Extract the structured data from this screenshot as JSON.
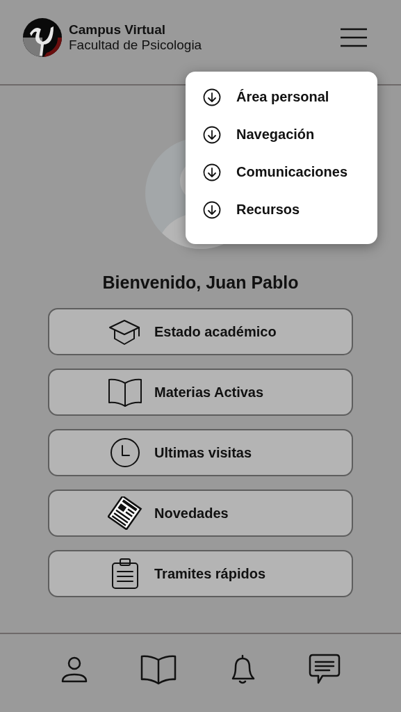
{
  "header": {
    "title": "Campus Virtual",
    "subtitle": "Facultad de Psicologia"
  },
  "menu": {
    "items": [
      {
        "label": "Área personal"
      },
      {
        "label": "Navegación"
      },
      {
        "label": "Comunicaciones"
      },
      {
        "label": "Recursos"
      }
    ]
  },
  "welcome": "Bienvenido, Juan Pablo",
  "actions": [
    {
      "label": "Estado académico"
    },
    {
      "label": "Materias Activas"
    },
    {
      "label": "Ultimas visitas"
    },
    {
      "label": "Novedades"
    },
    {
      "label": "Tramites rápidos"
    }
  ]
}
